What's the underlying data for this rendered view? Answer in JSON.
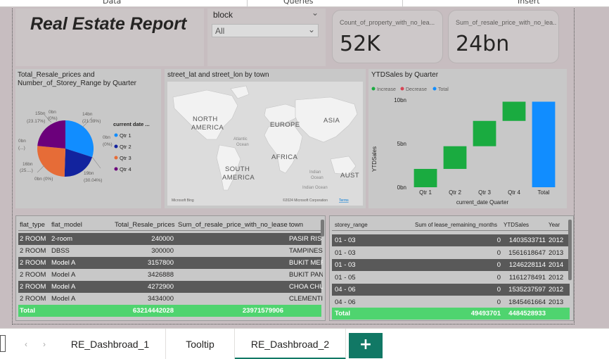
{
  "ribbon": {
    "tabs": [
      "Data",
      "Queries",
      "Insert"
    ]
  },
  "report": {
    "title": "Real Estate Report"
  },
  "slicer": {
    "label": "block",
    "value": "All"
  },
  "cards": [
    {
      "label": "Count_of_property_with_no_lea...",
      "value": "52K"
    },
    {
      "label": "Sum_of_resale_price_with_no_lea...",
      "value": "24bn"
    }
  ],
  "pie_visual": {
    "title_line1": "Total_Resale_prices and",
    "title_line2": "Number_of_Storey_Range by Quarter",
    "legend_title": "current date ...",
    "legend_items": [
      "Qtr 1",
      "Qtr 2",
      "Qtr 3",
      "Qtr 4"
    ],
    "colors": [
      "#118DFF",
      "#12239E",
      "#E66C37",
      "#6B007B"
    ],
    "labels": {
      "l_15bn": "15bn",
      "l_0bn_a": "0bn",
      "l_14bn": "14bn",
      "l_2317": "(23.17%)",
      "l_0pct_a": "(0%)",
      "l_2139": "(21.39%)",
      "l_0bn_b": "0bn",
      "l_0bn_c": "0bn",
      "l_0pct_b": "(0%)",
      "l_ellip": "(...)",
      "l_16bn": "16bn",
      "l_25": "(25....)",
      "l_19bn": "19bn",
      "l_5004": "(30.04%)",
      "l_0bn0": "0bn (0%)"
    }
  },
  "map_visual": {
    "title": "street_lat and street_lon by town",
    "labels": {
      "na1": "NORTH",
      "na2": "AMERICA",
      "eu": "EUROPE",
      "as": "ASIA",
      "af": "AFRICA",
      "sa1": "SOUTH",
      "sa2": "AMERICA",
      "au": "AUST",
      "ao1": "Atlantic",
      "ao2": "Ocean",
      "io1": "Indian",
      "io2": "Ocean",
      "io3": "Indian Ocean"
    },
    "attribution": "©2024 Microsoft Corporation",
    "terms": "Terms",
    "logo": "Microsoft Bing"
  },
  "waterfall": {
    "title": "YTDSales by Quarter",
    "legend": [
      {
        "label": "Increase",
        "color": "#1AAB40"
      },
      {
        "label": "Decrease",
        "color": "#D64554"
      },
      {
        "label": "Total",
        "color": "#118DFF"
      }
    ],
    "ylabel": "YTDSales",
    "xlabel": "current_date Quarter",
    "yticks": [
      "10bn",
      "5bn",
      "0bn"
    ]
  },
  "chart_data": {
    "type": "bar",
    "title": "YTDSales by Quarter",
    "xlabel": "current_date Quarter",
    "ylabel": "YTDSales",
    "categories": [
      "Qtr 1",
      "Qtr 2",
      "Qtr 3",
      "Qtr 4",
      "Total"
    ],
    "series": [
      {
        "name": "Increase",
        "values": [
          2.1,
          2.6,
          2.9,
          2.2,
          null
        ]
      },
      {
        "name": "Total",
        "values": [
          null,
          null,
          null,
          null,
          9.8
        ]
      }
    ],
    "base": [
      0,
      2.1,
      4.7,
      7.6,
      0
    ],
    "ylim": [
      0,
      10
    ],
    "yticks": [
      "0bn",
      "5bn",
      "10bn"
    ]
  },
  "table1": {
    "headers": [
      "flat_type",
      "flat_model",
      "Total_Resale_prices",
      "Sum_of_resale_price_with_no_lease",
      "town"
    ],
    "rows": [
      [
        "2 ROOM",
        "2-room",
        "240000",
        "",
        "PASIR RIS"
      ],
      [
        "2 ROOM",
        "DBSS",
        "300000",
        "",
        "TAMPINES"
      ],
      [
        "2 ROOM",
        "Model A",
        "3157800",
        "",
        "BUKIT MERA"
      ],
      [
        "2 ROOM",
        "Model A",
        "3426888",
        "",
        "BUKIT PANJ"
      ],
      [
        "2 ROOM",
        "Model A",
        "4272900",
        "",
        "CHOA CHU"
      ],
      [
        "2 ROOM",
        "Model A",
        "3434000",
        "",
        "CLEMENTI"
      ]
    ],
    "total": {
      "label": "Total",
      "total_resale": "63214442028",
      "sum_no_lease": "23971579906"
    }
  },
  "table2": {
    "headers": [
      "storey_range",
      "Sum of lease_remaining_months",
      "YTDSales",
      "Year"
    ],
    "rows": [
      [
        "01 - 03",
        "0",
        "1403533711",
        "2012"
      ],
      [
        "01 - 03",
        "0",
        "1561618647",
        "2013"
      ],
      [
        "01 - 03",
        "0",
        "1246228114",
        "2014"
      ],
      [
        "01 - 05",
        "0",
        "1161278491",
        "2012"
      ],
      [
        "04 - 06",
        "0",
        "1535237597",
        "2012"
      ],
      [
        "04 - 06",
        "0",
        "1845461664",
        "2013"
      ]
    ],
    "total": {
      "label": "Total",
      "sum_lease": "49493701",
      "ytd": "4484528933"
    }
  },
  "page_tabs": [
    "RE_Dashbroad_1",
    "Tooltip",
    "RE_Dashbroad_2"
  ],
  "add_tab": "+"
}
